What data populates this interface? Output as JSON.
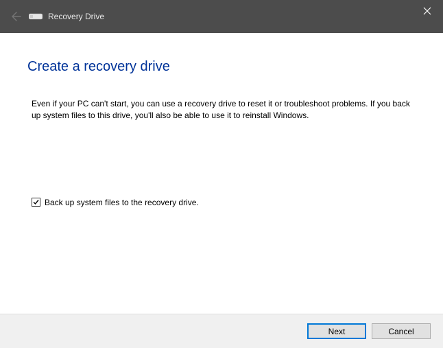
{
  "titlebar": {
    "title": "Recovery Drive"
  },
  "heading": "Create a recovery drive",
  "description": "Even if your PC can't start, you can use a recovery drive to reset it or troubleshoot problems. If you back up system files to this drive, you'll also be able to use it to reinstall Windows.",
  "checkbox": {
    "checked": true,
    "label": "Back up system files to the recovery drive."
  },
  "buttons": {
    "next": "Next",
    "cancel": "Cancel"
  }
}
